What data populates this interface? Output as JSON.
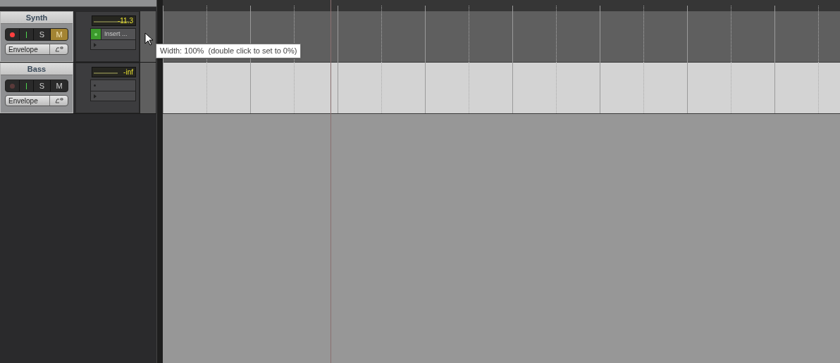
{
  "tracks": [
    {
      "name": "Synth",
      "armed": true,
      "muted": true,
      "selected": false,
      "meter": "-11.3",
      "level": 0.9,
      "solo": "S",
      "mute": "M",
      "envelope": "Envelope",
      "slots": [
        {
          "kind": "insert",
          "label": "Insert ...",
          "on": true
        },
        {
          "kind": "send"
        }
      ]
    },
    {
      "name": "Bass",
      "armed": false,
      "muted": false,
      "selected": true,
      "meter": "-inf",
      "level": 0.6,
      "solo": "S",
      "mute": "M",
      "envelope": "Envelope",
      "slots": [
        {
          "kind": "empty"
        },
        {
          "kind": "send"
        }
      ]
    }
  ],
  "tooltip": "Width: 100%  (double click to set to 0%)"
}
